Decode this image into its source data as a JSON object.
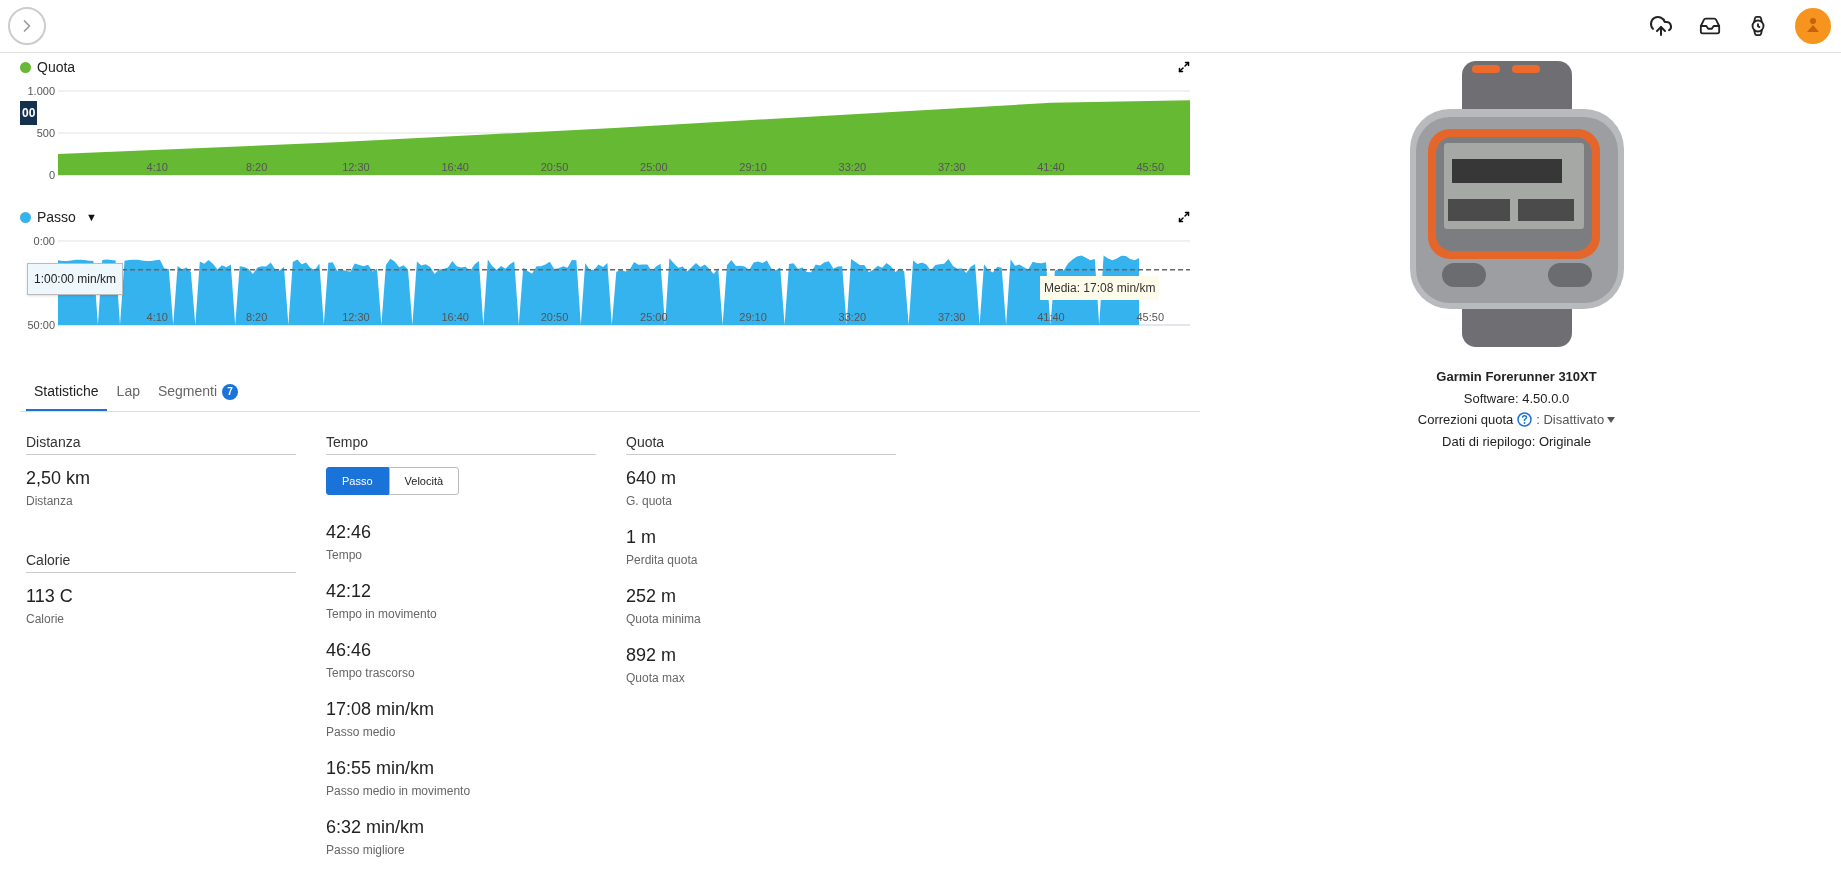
{
  "charts": [
    {
      "kind": "plot",
      "crosshair_label": "00",
      "chart_data": {
        "type": "area",
        "title": "Quota",
        "x": [
          0,
          700,
          1400,
          2100,
          2500,
          2850
        ],
        "series": [
          {
            "color": "#66b933",
            "values": [
              250,
              390,
              560,
              750,
              860,
              890
            ]
          }
        ],
        "xlim": [
          0,
          2850
        ],
        "ylim": [
          0,
          1000
        ],
        "yticks": [
          {
            "value": 0,
            "label": "0"
          },
          {
            "value": 500,
            "label": "500"
          },
          {
            "value": 1000,
            "label": "1.000"
          }
        ],
        "xticks": [
          {
            "value": 250,
            "label": "4:10"
          },
          {
            "value": 500,
            "label": "8:20"
          },
          {
            "value": 750,
            "label": "12:30"
          },
          {
            "value": 1000,
            "label": "16:40"
          },
          {
            "value": 1250,
            "label": "20:50"
          },
          {
            "value": 1500,
            "label": "25:00"
          },
          {
            "value": 1750,
            "label": "29:10"
          },
          {
            "value": 2000,
            "label": "33:20"
          },
          {
            "value": 2250,
            "label": "37:30"
          },
          {
            "value": 2500,
            "label": "41:40"
          },
          {
            "value": 2750,
            "label": "45:50"
          }
        ]
      }
    },
    {
      "kind": "waveform",
      "title": "Passo",
      "color": "#35b3ee",
      "has_dropdown": true,
      "dropdown_glyph": "▼",
      "y_axis_labels": [
        "0:00",
        "50:00"
      ],
      "x_axis_labels": [
        "4:10",
        "8:20",
        "12:30",
        "16:40",
        "20:50",
        "25:00",
        "29:10",
        "33:20",
        "37:30",
        "41:40",
        "45:50"
      ],
      "average_label": "Media: 17:08 min/km",
      "tooltip": "1:00:00 min/km"
    }
  ],
  "tabs": [
    {
      "label": "Statistiche",
      "selected": true
    },
    {
      "label": "Lap",
      "selected": false
    },
    {
      "label": "Segmenti",
      "selected": false,
      "badge": "7"
    }
  ],
  "stat_columns": [
    {
      "groups": [
        {
          "heading": "Distanza",
          "items": [
            {
              "value": "2,50 km",
              "label": "Distanza"
            }
          ]
        },
        {
          "heading": "Calorie",
          "items": [
            {
              "value": "113 C",
              "label": "Calorie"
            }
          ]
        }
      ]
    },
    {
      "groups": [
        {
          "heading": "Tempo",
          "toggle": [
            {
              "label": "Passo",
              "selected": true
            },
            {
              "label": "Velocità",
              "selected": false
            }
          ],
          "items": [
            {
              "value": "42:46",
              "label": "Tempo"
            },
            {
              "value": "42:12",
              "label": "Tempo in movimento"
            },
            {
              "value": "46:46",
              "label": "Tempo trascorso"
            },
            {
              "value": "17:08 min/km",
              "label": "Passo medio"
            },
            {
              "value": "16:55 min/km",
              "label": "Passo medio in movimento"
            },
            {
              "value": "6:32 min/km",
              "label": "Passo migliore"
            }
          ]
        }
      ]
    },
    {
      "groups": [
        {
          "heading": "Quota",
          "items": [
            {
              "value": "640 m",
              "label": "G. quota"
            },
            {
              "value": "1 m",
              "label": "Perdita quota"
            },
            {
              "value": "252 m",
              "label": "Quota minima"
            },
            {
              "value": "892 m",
              "label": "Quota max"
            }
          ]
        }
      ]
    }
  ],
  "device": {
    "name": "Garmin Forerunner 310XT",
    "software": "Software: 4.50.0.0",
    "correction_label": "Correzioni quota",
    "correction_value": ": Disattivato",
    "summary": "Dati di riepilogo: Originale"
  }
}
